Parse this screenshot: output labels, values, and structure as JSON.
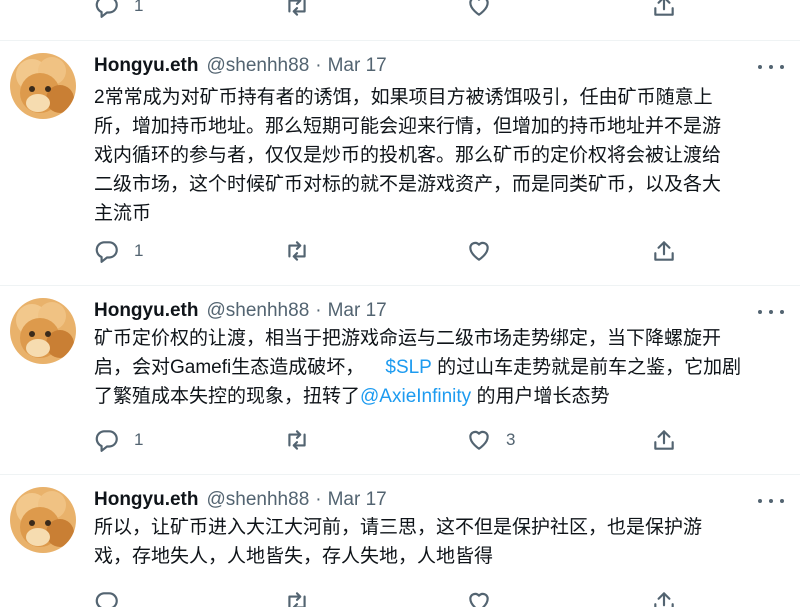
{
  "top_actions": {
    "reply_count": "1"
  },
  "tweets": [
    {
      "name": "Hongyu.eth",
      "handle": "@shenhh88",
      "separator": "·",
      "date": "Mar 17",
      "lines": [
        "2常常成为对矿币持有者的诱饵，如果项目方被诱饵吸引，任由矿币随意上",
        "所，增加持币地址。那么短期可能会迎来行情，但增加的持币地址并不是游",
        "戏内循环的参与者，仅仅是炒币的投机客。那么矿币的定价权将会被让渡给",
        "二级市场，这个时候矿币对标的就不是游戏资产，而是同类矿币，以及各大",
        "主流币"
      ],
      "reply_count": "1",
      "like_count": ""
    },
    {
      "name": "Hongyu.eth",
      "handle": "@shenhh88",
      "separator": "·",
      "date": "Mar 17",
      "line1": "矿币定价权的让渡，相当于把游戏命运与二级市场走势绑定，当下降螺旋开",
      "line2_a": "启，会对Gamefi生态造成破坏，",
      "line2_link": "$SLP",
      "line2_b": "的过山车走势就是前车之鉴，它加剧",
      "line3_a": "了繁殖成本失控的现象，扭转了",
      "line3_link": "@AxieInfinity",
      "line3_b": "的用户增长态势",
      "reply_count": "1",
      "like_count": "3"
    },
    {
      "name": "Hongyu.eth",
      "handle": "@shenhh88",
      "separator": "·",
      "date": "Mar 17",
      "lines": [
        "所以，让矿币进入大江大河前，请三思，这不但是保护社区，也是保护游",
        "戏，存地失人，人地皆失，存人失地，人地皆得"
      ]
    }
  ]
}
